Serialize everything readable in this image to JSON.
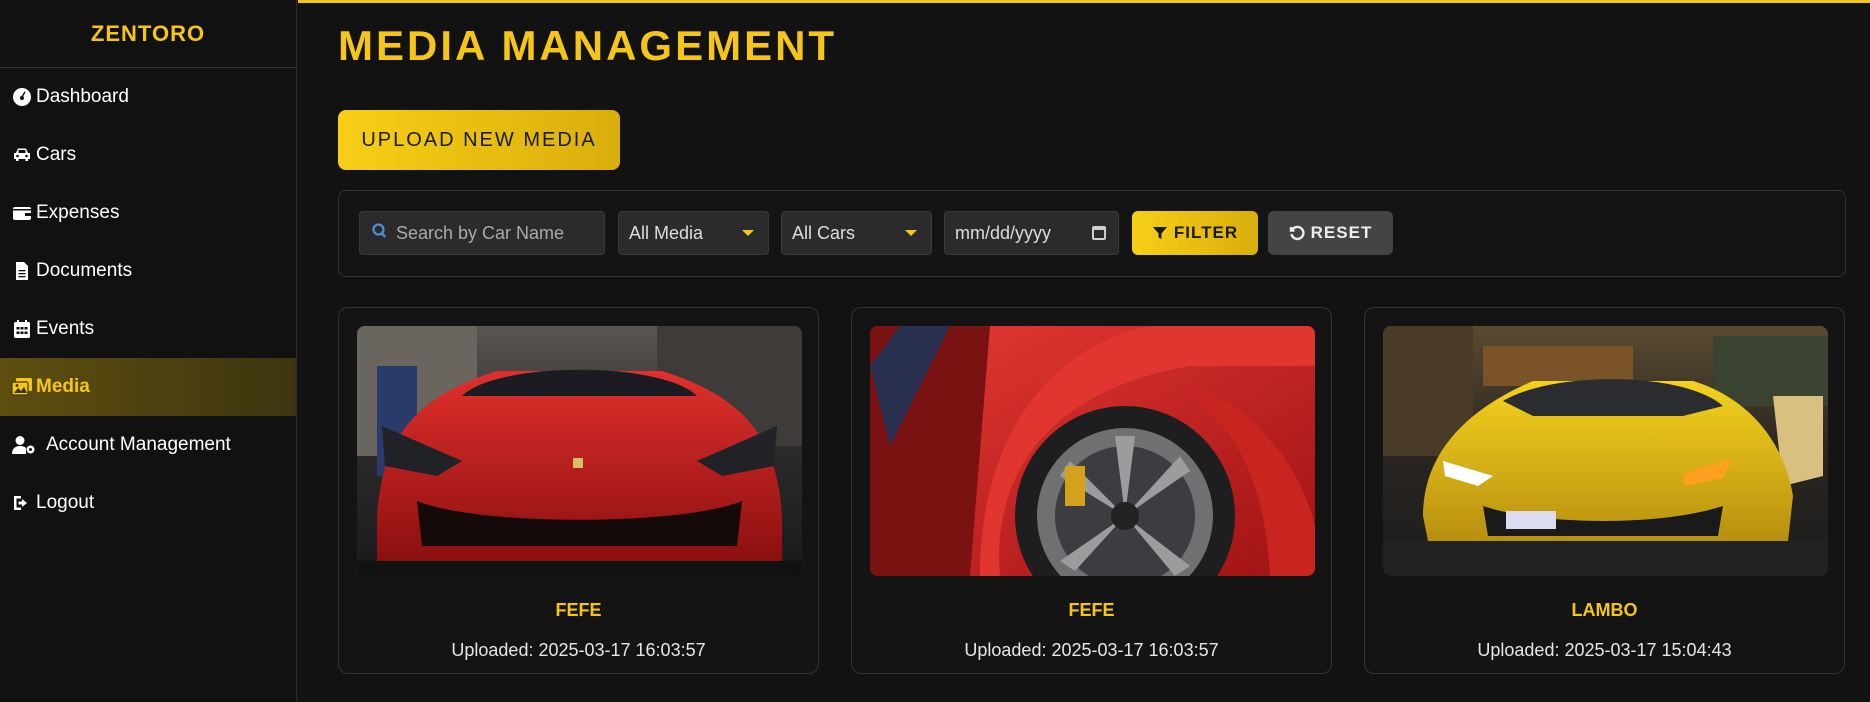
{
  "brand": "ZENTORO",
  "sidebar": {
    "items": [
      {
        "label": "Dashboard",
        "icon": "gauge-icon"
      },
      {
        "label": "Cars",
        "icon": "car-icon"
      },
      {
        "label": "Expenses",
        "icon": "wallet-icon"
      },
      {
        "label": "Documents",
        "icon": "file-icon"
      },
      {
        "label": "Events",
        "icon": "calendar-icon"
      },
      {
        "label": "Media",
        "icon": "images-icon",
        "active": true
      },
      {
        "label": "Account Management",
        "icon": "user-gear-icon"
      },
      {
        "label": "Logout",
        "icon": "logout-icon"
      }
    ]
  },
  "page": {
    "title": "MEDIA MANAGEMENT",
    "upload_label": "UPLOAD NEW MEDIA"
  },
  "filters": {
    "search_placeholder": "Search by Car Name",
    "media_select": "All Media",
    "cars_select": "All Cars",
    "date_placeholder": "mm/dd/yyyy",
    "filter_label": "FILTER",
    "reset_label": "RESET"
  },
  "media": [
    {
      "name": "FEFE",
      "uploaded": "Uploaded: 2025-03-17 16:03:57"
    },
    {
      "name": "FEFE",
      "uploaded": "Uploaded: 2025-03-17 16:03:57"
    },
    {
      "name": "LAMBO",
      "uploaded": "Uploaded: 2025-03-17 15:04:43"
    }
  ],
  "colors": {
    "accent": "#f5c518",
    "background": "#121212",
    "panel": "#141414",
    "active_nav": "#4e4312"
  }
}
